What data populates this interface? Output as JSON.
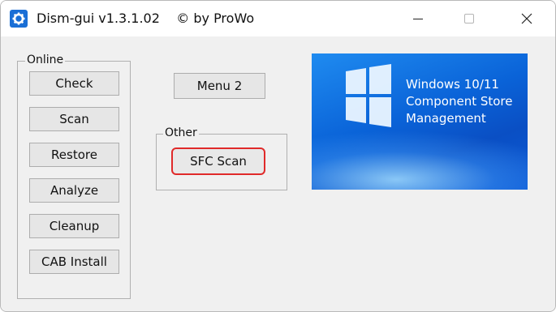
{
  "window": {
    "title": "Dism-gui v1.3.1.02",
    "copyright": "© by ProWo",
    "minimize_label": "",
    "maximize_label": "",
    "close_label": ""
  },
  "online_group": {
    "legend": "Online",
    "buttons": [
      "Check",
      "Scan",
      "Restore",
      "Analyze",
      "Cleanup",
      "CAB Install"
    ]
  },
  "menu2_button": "Menu 2",
  "other_group": {
    "legend": "Other",
    "sfc_button": "SFC Scan"
  },
  "banner": {
    "lines": [
      "Windows 10/11",
      "Component Store",
      "Management"
    ]
  },
  "colors": {
    "app_icon": "#1a6fd6",
    "highlight_border": "#e02a2a",
    "banner_blue": "#0a63d8"
  }
}
